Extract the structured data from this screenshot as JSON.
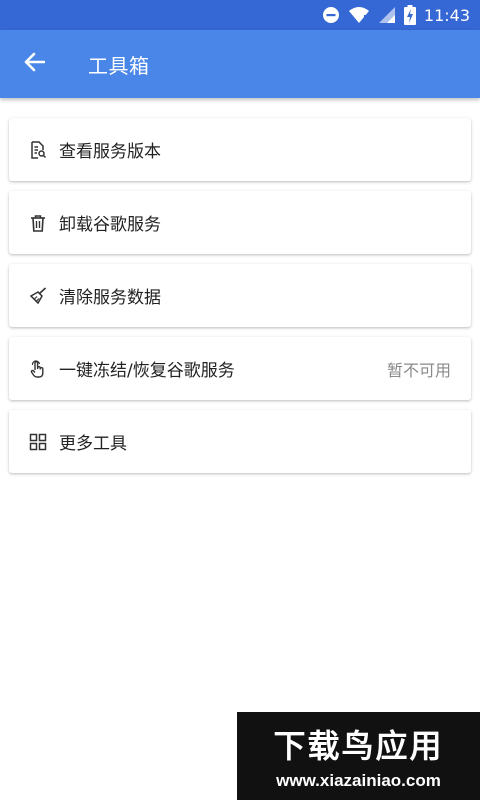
{
  "statusbar": {
    "time": "11:43",
    "icons": [
      "minus-circle-icon",
      "wifi-icon",
      "signal-icon",
      "battery-charging-icon"
    ]
  },
  "appbar": {
    "back_icon": "arrow-left-icon",
    "title": "工具箱"
  },
  "items": [
    {
      "label": "查看服务版本",
      "icon": "document-search-icon",
      "status": ""
    },
    {
      "label": "卸载谷歌服务",
      "icon": "trash-icon",
      "status": ""
    },
    {
      "label": "清除服务数据",
      "icon": "broom-icon",
      "status": ""
    },
    {
      "label": "一键冻结/恢复谷歌服务",
      "icon": "touch-icon",
      "status": "暂不可用"
    },
    {
      "label": "更多工具",
      "icon": "grid-icon",
      "status": ""
    }
  ],
  "watermark": {
    "brand": "下载鸟应用",
    "url": "www.xiazainiao.com"
  },
  "colors": {
    "statusbar_bg": "#3568d4",
    "appbar_bg": "#4a86e8",
    "status_text": "#8a8a8a"
  }
}
